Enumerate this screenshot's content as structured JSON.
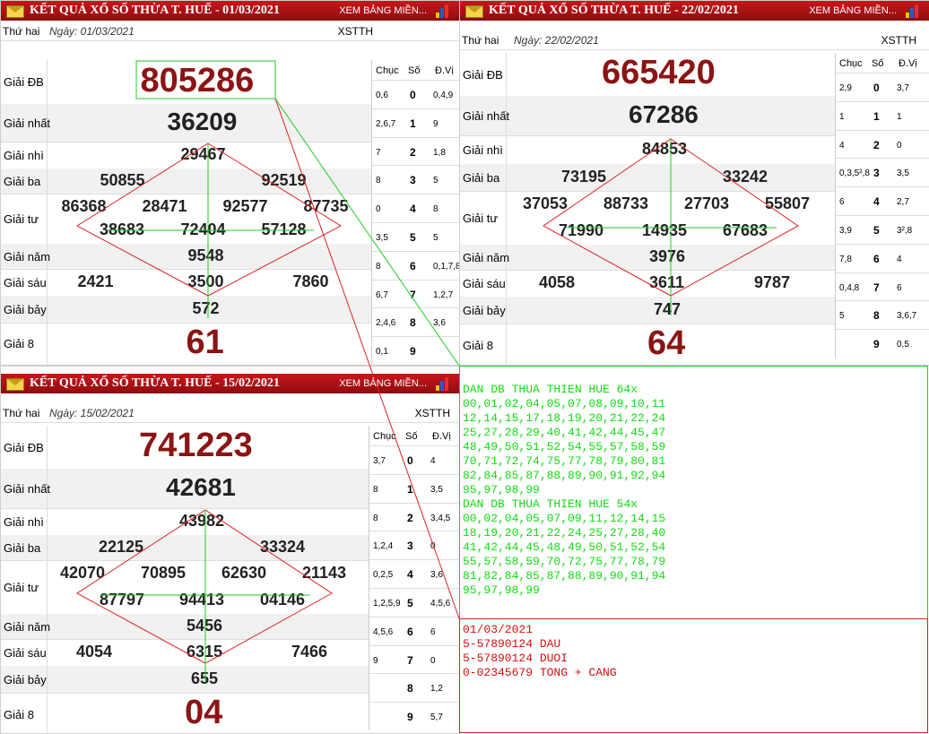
{
  "panel1": {
    "title": "KẾT QUẢ XỔ SỐ THỪA T. HUẾ - 01/03/2021",
    "more": "XEM BẢNG MIỀN...",
    "dow": "Thứ hai",
    "date": "Ngày: 01/03/2021",
    "code": "XSTTH",
    "labels": [
      "Giải ĐB",
      "Giải nhất",
      "Giải nhì",
      "Giải ba",
      "Giải tư",
      "Giải năm",
      "Giải sáu",
      "Giải bảy",
      "Giải 8"
    ],
    "db": "805286",
    "g1": "36209",
    "g2": "29467",
    "g3": [
      "50855",
      "92519"
    ],
    "g4a": [
      "86368",
      "28471",
      "92577",
      "87735"
    ],
    "g4b": [
      "38683",
      "72404",
      "57128"
    ],
    "g5": "9548",
    "g6": [
      "2421",
      "3500",
      "7860"
    ],
    "g7": "572",
    "g8": "61",
    "side_headers": [
      "Chục",
      "Số",
      "Đ.Vị"
    ],
    "side": [
      [
        "0,6",
        "0",
        "0,4,9"
      ],
      [
        "2,6,7",
        "1",
        "9"
      ],
      [
        "7",
        "2",
        "1,8"
      ],
      [
        "8",
        "3",
        "5"
      ],
      [
        "0",
        "4",
        "8"
      ],
      [
        "3,5",
        "5",
        "5"
      ],
      [
        "8",
        "6",
        "0,1,7,8"
      ],
      [
        "6,7",
        "7",
        "1,2,7"
      ],
      [
        "2,4,6",
        "8",
        "3,6"
      ],
      [
        "0,1",
        "9",
        ""
      ]
    ]
  },
  "panel2": {
    "title": "KẾT QUẢ XỔ SỐ THỪA T. HUẾ - 22/02/2021",
    "more": "XEM BẢNG MIỀN...",
    "dow": "Thứ hai",
    "date": "Ngày: 22/02/2021",
    "code": "XSTTH",
    "labels": [
      "Giải ĐB",
      "Giải nhất",
      "Giải nhì",
      "Giải ba",
      "Giải tư",
      "Giải năm",
      "Giải sáu",
      "Giải bảy",
      "Giải 8"
    ],
    "db": "665420",
    "g1": "67286",
    "g2": "84853",
    "g3": [
      "73195",
      "33242"
    ],
    "g4a": [
      "37053",
      "88733",
      "27703",
      "55807"
    ],
    "g4b": [
      "71990",
      "14935",
      "67683"
    ],
    "g5": "3976",
    "g6": [
      "4058",
      "3611",
      "9787"
    ],
    "g7": "747",
    "g8": "64",
    "side_headers": [
      "Chục",
      "Số",
      "Đ.Vị"
    ],
    "side": [
      [
        "2,9",
        "0",
        "3,7"
      ],
      [
        "1",
        "1",
        "1"
      ],
      [
        "4",
        "2",
        "0"
      ],
      [
        "0,3,5²,8",
        "3",
        "3,5"
      ],
      [
        "6",
        "4",
        "2,7"
      ],
      [
        "3,9",
        "5",
        "3²,8"
      ],
      [
        "7,8",
        "6",
        "4"
      ],
      [
        "0,4,8",
        "7",
        "6"
      ],
      [
        "5",
        "8",
        "3,6,7"
      ],
      [
        "",
        "9",
        "0,5"
      ]
    ]
  },
  "panel3": {
    "title": "KẾT QUẢ XỔ SỐ THỪA T. HUẾ - 15/02/2021",
    "more": "XEM BẢNG MIỀN...",
    "dow": "Thứ hai",
    "date": "Ngày: 15/02/2021",
    "code": "XSTTH",
    "labels": [
      "Giải ĐB",
      "Giải nhất",
      "Giải nhì",
      "Giải ba",
      "Giải tư",
      "Giải năm",
      "Giải sáu",
      "Giải bảy",
      "Giải 8"
    ],
    "db": "741223",
    "g1": "42681",
    "g2": "43982",
    "g3": [
      "22125",
      "33324"
    ],
    "g4a": [
      "42070",
      "70895",
      "62630",
      "21143"
    ],
    "g4b": [
      "87797",
      "94413",
      "04146"
    ],
    "g5": "5456",
    "g6": [
      "4054",
      "6315",
      "7466"
    ],
    "g7": "655",
    "g8": "04",
    "side_headers": [
      "Chục",
      "Số",
      "Đ.Vị"
    ],
    "side": [
      [
        "3,7",
        "0",
        "4"
      ],
      [
        "8",
        "1",
        "3,5"
      ],
      [
        "8",
        "2",
        "3,4,5"
      ],
      [
        "1,2,4",
        "3",
        "0"
      ],
      [
        "0,2,5",
        "4",
        "3,6"
      ],
      [
        "1,2,5,9",
        "5",
        "4,5,6"
      ],
      [
        "4,5,6",
        "6",
        "6"
      ],
      [
        "9",
        "7",
        "0"
      ],
      [
        "",
        "8",
        "1,2"
      ],
      [
        "",
        "9",
        "5,7"
      ]
    ]
  },
  "green_lines": [
    "DAN DB THUA THIEN HUE 64x",
    "00,01,02,04,05,07,08,09,10,11",
    "12,14,15,17,18,19,20,21,22,24",
    "25,27,28,29,40,41,42,44,45,47",
    "48,49,50,51,52,54,55,57,58,59",
    "70,71,72,74,75,77,78,79,80,81",
    "82,84,85,87,88,89,90,91,92,94",
    "95,97,98,99",
    "DAN DB THUA THIEN HUE 54x",
    "00,02,04,05,07,09,11,12,14,15",
    "18,19,20,21,22,24,25,27,28,40",
    "41,42,44,45,48,49,50,51,52,54",
    "55,57,58,59,70,72,75,77,78,79",
    "81,82,84,85,87,88,89,90,91,94",
    "95,97,98,99"
  ],
  "red_lines": [
    "01/03/2021",
    "5-57890124 DAU",
    "5-57890124 DUOI",
    "0-02345679 TONG + CANG"
  ]
}
